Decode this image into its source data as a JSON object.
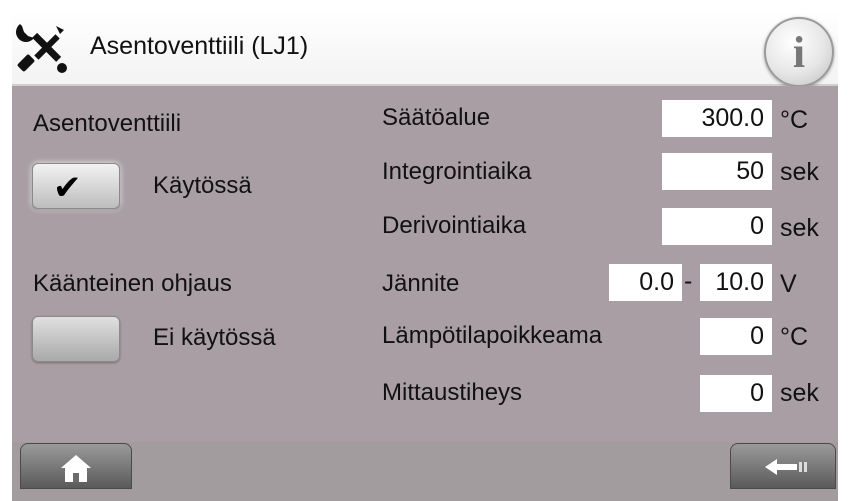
{
  "header": {
    "title": "Asentoventtiili (LJ1)",
    "tools_icon": "wrench-screwdriver-icon",
    "info_icon": "info-icon",
    "info_glyph": "i"
  },
  "left": {
    "section1_label": "Asentoventtiili",
    "toggle1": {
      "state": "checked",
      "status_label": "Käytössä"
    },
    "section2_label": "Käänteinen ohjaus",
    "toggle2": {
      "state": "unchecked",
      "status_label": "Ei käytössä"
    }
  },
  "params": {
    "saatoalue": {
      "label": "Säätöalue",
      "value": "300.0",
      "unit": "°C"
    },
    "integrointiaika": {
      "label": "Integrointiaika",
      "value": "50",
      "unit": "sek"
    },
    "derivointiaika": {
      "label": "Derivointiaika",
      "value": "0",
      "unit": "sek"
    },
    "jannite": {
      "label": "Jännite",
      "min": "0.0",
      "separator": "-",
      "max": "10.0",
      "unit": "V"
    },
    "lampotilapoikkeama": {
      "label": "Lämpötilapoikkeama",
      "value": "0",
      "unit": "°C"
    },
    "mittaustiheys": {
      "label": "Mittaustiheys",
      "value": "0",
      "unit": "sek"
    }
  },
  "footer": {
    "home_icon": "home-icon",
    "back_icon": "back-arrow-icon"
  },
  "colors": {
    "panel": "#a89ea3",
    "footer": "#a39c9f",
    "field": "#ffffff"
  }
}
